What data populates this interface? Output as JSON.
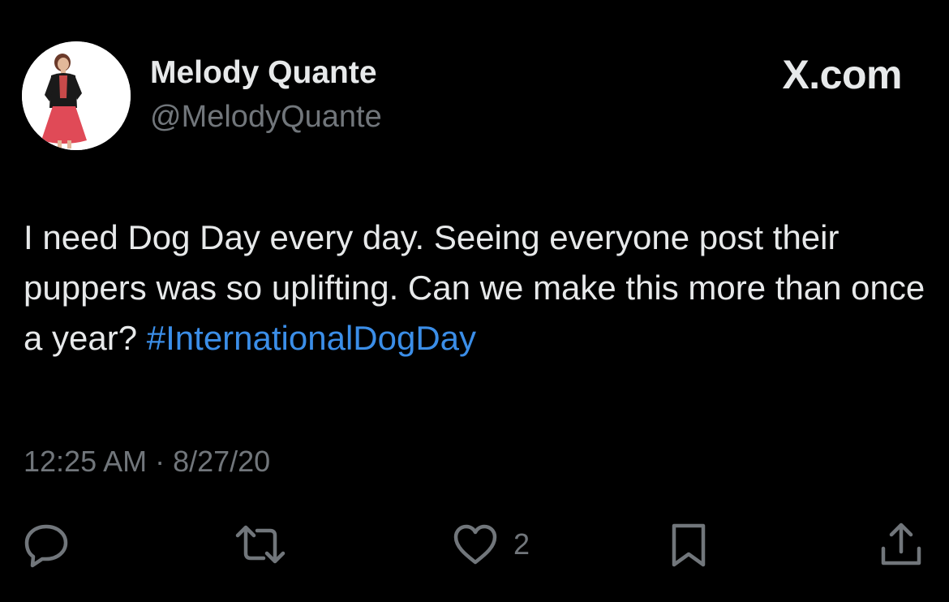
{
  "author": {
    "display_name": "Melody Quante",
    "handle": "@MelodyQuante"
  },
  "brand": {
    "label": "X.com"
  },
  "tweet": {
    "text": "I need Dog Day every day. Seeing everyone post their puppers was so uplifting. Can we make this more than once a year?",
    "hashtag": "#InternationalDogDay",
    "timestamp": "12:25 AM · 8/27/20"
  },
  "actions": {
    "reply_icon": "speech-bubble-icon",
    "retweet_icon": "retweet-arrows-icon",
    "like_icon": "heart-icon",
    "like_count": "2",
    "bookmark_icon": "bookmark-icon",
    "share_icon": "share-upload-icon"
  },
  "colors": {
    "background": "#000000",
    "primary_text": "#e7e9ea",
    "secondary_text": "#71767b",
    "hashtag": "#3b8ee8"
  }
}
